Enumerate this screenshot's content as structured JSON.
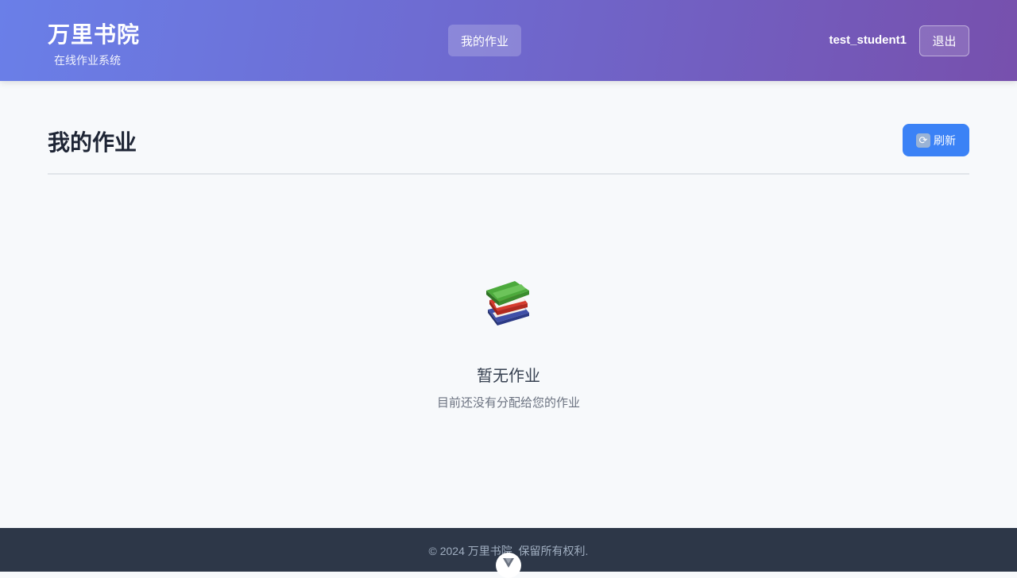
{
  "header": {
    "brand_title": "万里书院",
    "brand_subtitle": "在线作业系统",
    "nav": [
      {
        "label": "我的作业",
        "active": true
      }
    ],
    "username": "test_student1",
    "logout_label": "退出"
  },
  "main": {
    "title": "我的作业",
    "refresh_label": "刷新",
    "refresh_icon": "refresh-icon",
    "empty_state": {
      "icon": "books-icon",
      "title": "暂无作业",
      "description": "目前还没有分配给您的作业"
    }
  },
  "footer": {
    "copyright": "© 2024 万里书院. 保留所有权利."
  },
  "colors": {
    "header_gradient_start": "#6a7fe8",
    "header_gradient_end": "#7750ad",
    "primary_button": "#3b82f6",
    "footer_bg": "#2d3748",
    "page_bg": "#f7f9fb"
  }
}
